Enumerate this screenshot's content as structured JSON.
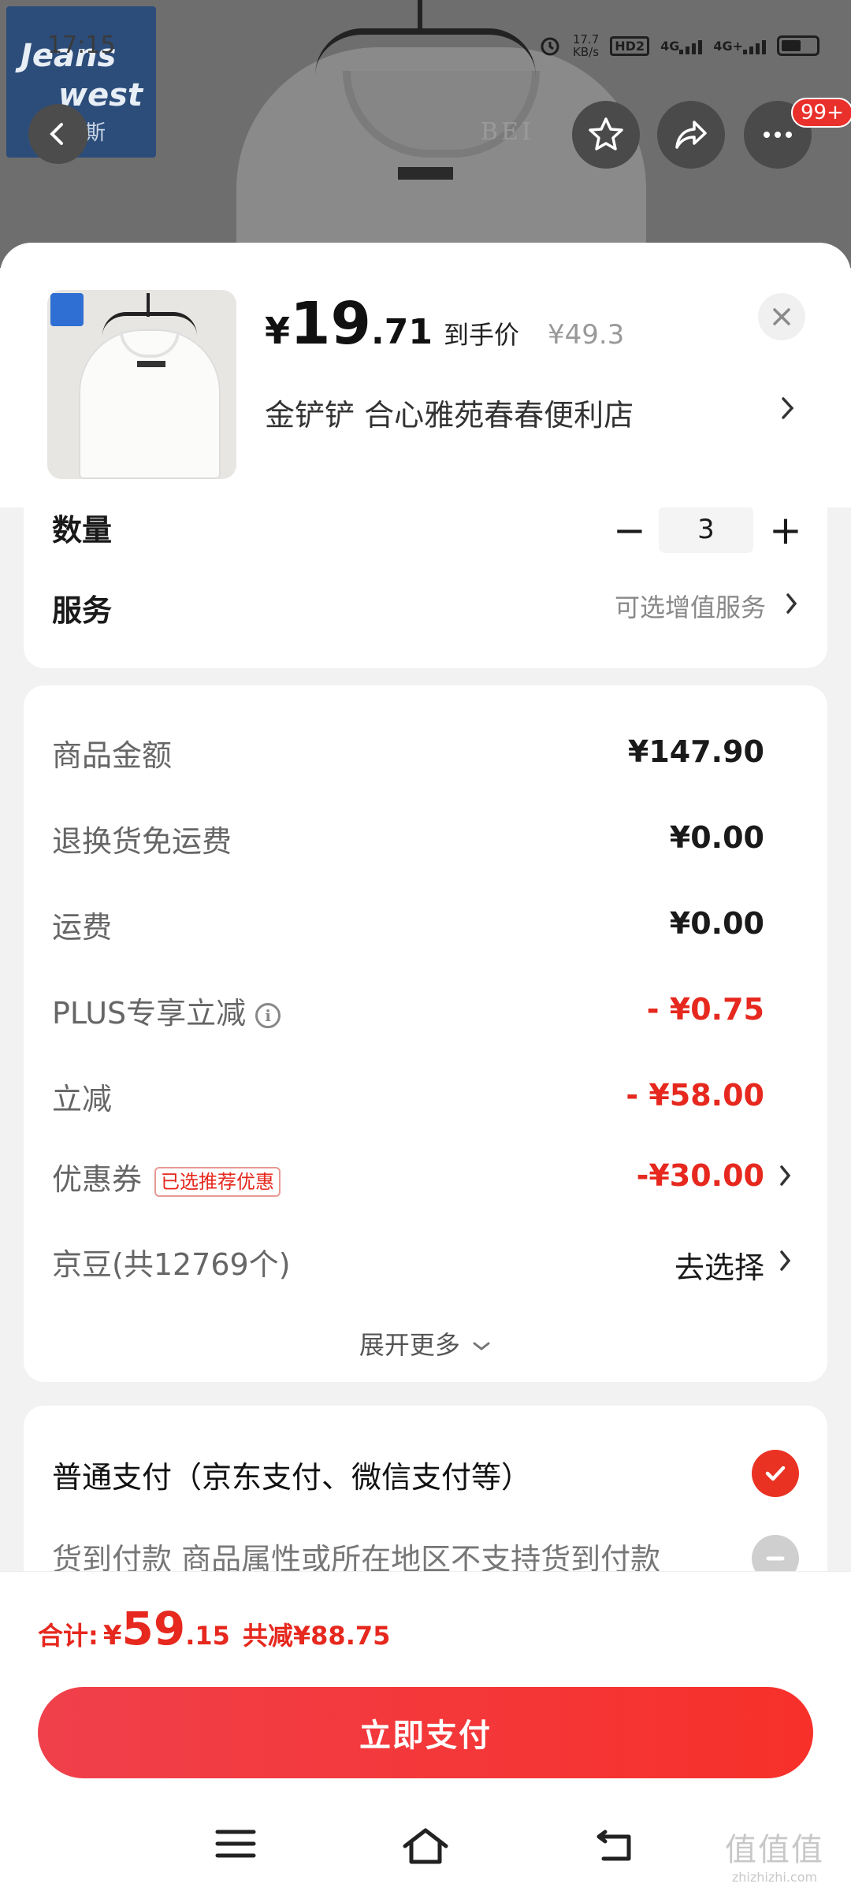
{
  "status_bar": {
    "time": "17:15",
    "net_speed": "17.7\nKB/s",
    "net_speed_value": "17.7",
    "net_speed_unit": "KB/s",
    "hd": "HD2",
    "sig1": "4G",
    "sig2": "4G+"
  },
  "background": {
    "brand_line1": "Jeans",
    "brand_line2": "west",
    "brand_line3": "真维斯",
    "tag_text": "BEI",
    "badge": "99+"
  },
  "header": {
    "price_symbol": "¥",
    "price_int": "19",
    "price_dec": ".71",
    "price_label": "到手价",
    "price_old": "¥49.3",
    "spec": "金铲铲  合心雅苑春春便利店"
  },
  "quantity": {
    "label": "数量",
    "value": "3"
  },
  "service": {
    "label": "服务",
    "value": "可选增值服务"
  },
  "summary": {
    "rows": [
      {
        "label": "商品金额",
        "value": "¥147.90"
      },
      {
        "label": "退换货免运费",
        "value": "¥0.00"
      },
      {
        "label": "运费",
        "value": "¥0.00"
      },
      {
        "label": "PLUS专享立减",
        "value": "- ¥0.75"
      },
      {
        "label": "立减",
        "value": "- ¥58.00"
      },
      {
        "label": "优惠券",
        "tag": "已选推荐优惠",
        "value": "-¥30.00"
      },
      {
        "label": "京豆(共12769个)",
        "value": "去选择"
      }
    ],
    "expand": "展开更多"
  },
  "payment": {
    "option1": "普通支付（京东支付、微信支付等）",
    "option2": "货到付款  商品属性或所在地区不支持货到付款"
  },
  "bottom": {
    "total_label": "合计:",
    "total_symbol": "¥",
    "total_int": "59",
    "total_dec": ".15",
    "total_saved": "共减¥88.75",
    "pay_button": "立即支付"
  },
  "watermark": {
    "line1": "值值值",
    "line2": "zhizhizhi.com"
  },
  "colors": {
    "accent": "#e6281e",
    "pay_button": "#f23a33"
  }
}
